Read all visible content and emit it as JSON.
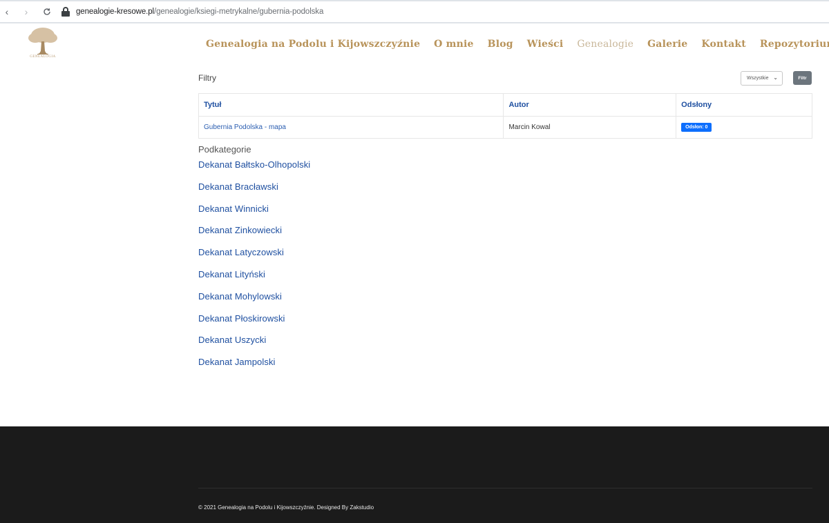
{
  "browser": {
    "url_domain": "genealogie-kresowe.pl",
    "url_path": "/genealogie/ksiegi-metrykalne/gubernia-podolska"
  },
  "logo": {
    "text": "GENEALOGIA"
  },
  "nav": {
    "items": [
      {
        "label": "Genealogia na Podolu i Kijowszczyźnie"
      },
      {
        "label": "O mnie"
      },
      {
        "label": "Blog"
      },
      {
        "label": "Wieści"
      },
      {
        "label": "Genealogie"
      },
      {
        "label": "Galerie"
      },
      {
        "label": "Kontakt"
      },
      {
        "label": "Repozytorium"
      }
    ],
    "active_index": 4
  },
  "filters": {
    "label": "Filtry",
    "select_value": "Wszystkie",
    "button_label": "Filtr"
  },
  "table": {
    "headers": [
      "Tytuł",
      "Autor",
      "Odsłony"
    ],
    "rows": [
      {
        "title": "Gubernia Podolska - mapa",
        "author": "Marcin Kowal",
        "views": "Odsłon: 0"
      }
    ]
  },
  "subcategories": {
    "heading": "Podkategorie",
    "items": [
      "Dekanat Bałtsko-Olhopolski",
      "Dekanat Bracławski",
      "Dekanat Winnicki",
      "Dekanat Zinkowiecki",
      "Dekanat Latyczowski",
      "Dekanat Lityński",
      "Dekanat Mohylowski",
      "Dekanat Płoskirowski",
      "Dekanat Uszycki",
      "Dekanat Jampolski"
    ]
  },
  "footer": {
    "copyright": "© 2021 Genealogia na Podolu i Kijowszczyźnie. Designed By Zakstudio"
  },
  "colors": {
    "nav": "#b8935a",
    "nav_active": "#c9b79a",
    "link": "#1e4fa0",
    "badge": "#0d6efd",
    "footer_bg": "#1b1b1b"
  }
}
